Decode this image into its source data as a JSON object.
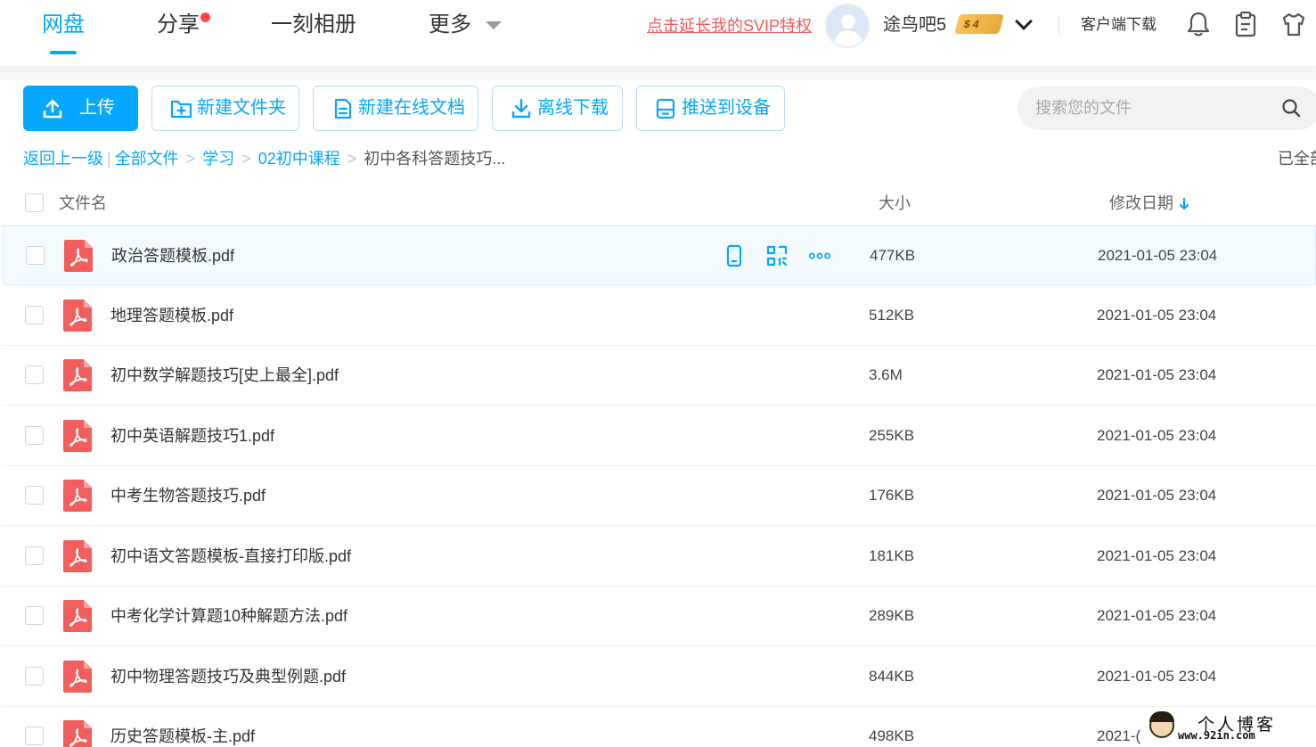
{
  "nav": {
    "tabs": [
      {
        "label": "网盘"
      },
      {
        "label": "分享"
      },
      {
        "label": "一刻相册"
      },
      {
        "label": "更多"
      }
    ],
    "svip_link": "点击延长我的SVIP特权",
    "username": "途鸟吧5",
    "vip_badge": "$ 4",
    "client_download": "客户端下载",
    "accent_color": "#06a7ff"
  },
  "toolbar": {
    "upload": "上传",
    "new_folder": "新建文件夹",
    "new_online_doc": "新建在线文档",
    "offline_download": "离线下载",
    "push_to_device": "推送到设备",
    "search_placeholder": "搜索您的文件"
  },
  "breadcrumb": {
    "back": "返回上一级",
    "items": [
      "全部文件",
      "学习",
      "02初中课程"
    ],
    "current": "初中各科答题技巧...",
    "status": "已全部"
  },
  "table": {
    "col_name": "文件名",
    "col_size": "大小",
    "col_date": "修改日期",
    "rows": [
      {
        "name": "政治答题模板.pdf",
        "size": "477KB",
        "date": "2021-01-05 23:04"
      },
      {
        "name": "地理答题模板.pdf",
        "size": "512KB",
        "date": "2021-01-05 23:04"
      },
      {
        "name": "初中数学解题技巧[史上最全].pdf",
        "size": "3.6M",
        "date": "2021-01-05 23:04"
      },
      {
        "name": "初中英语解题技巧1.pdf",
        "size": "255KB",
        "date": "2021-01-05 23:04"
      },
      {
        "name": "中考生物答题技巧.pdf",
        "size": "176KB",
        "date": "2021-01-05 23:04"
      },
      {
        "name": "初中语文答题模板-直接打印版.pdf",
        "size": "181KB",
        "date": "2021-01-05 23:04"
      },
      {
        "name": "中考化学计算题10种解题方法.pdf",
        "size": "289KB",
        "date": "2021-01-05 23:04"
      },
      {
        "name": "初中物理答题技巧及典型例题.pdf",
        "size": "844KB",
        "date": "2021-01-05 23:04"
      },
      {
        "name": "历史答题模板-主.pdf",
        "size": "498KB",
        "date": "2021-("
      }
    ]
  },
  "watermark": {
    "title": "个人博客",
    "url": "www.92in.com"
  }
}
